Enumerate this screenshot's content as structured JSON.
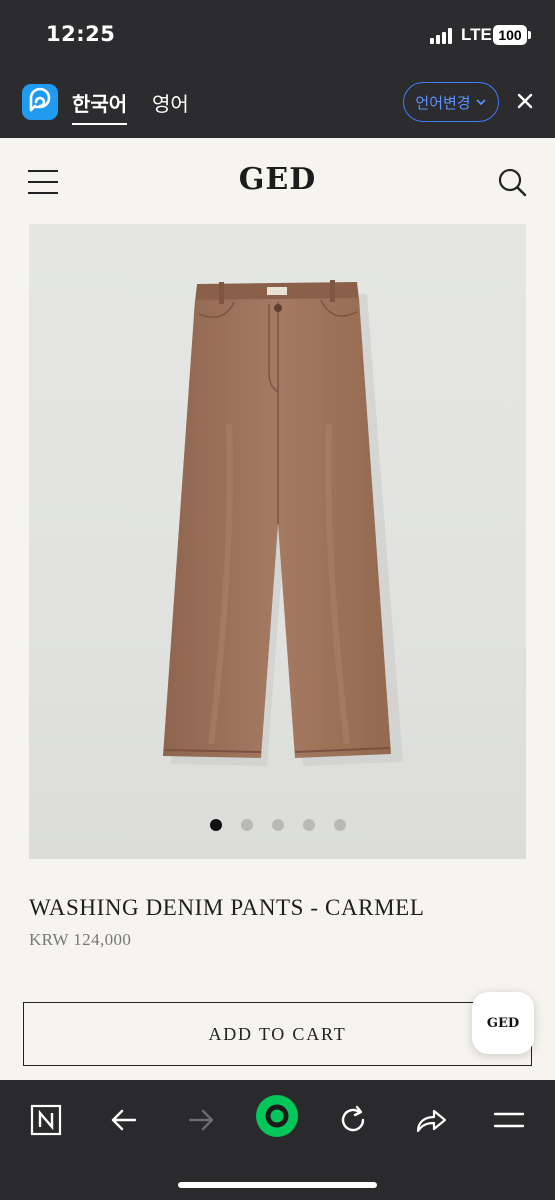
{
  "status_bar": {
    "time": "12:25",
    "network": "LTE",
    "battery": "100"
  },
  "translate_bar": {
    "tab_active": "한국어",
    "tab_other": "영어",
    "change_language": "언어변경"
  },
  "site": {
    "logo": "GED"
  },
  "product": {
    "title": "WASHING DENIM PANTS - CARMEL",
    "price": "KRW 124,000",
    "add_to_cart": "ADD TO CART",
    "image_count": 5,
    "active_image": 1
  },
  "floating_badge": {
    "label": "GED"
  },
  "colors": {
    "chrome_dark": "#2c2c2e",
    "accent_blue": "#3d7dff",
    "page_bg": "#f6f4ef",
    "naver_green": "#03c75a",
    "pants_brown": "#9a6f58"
  },
  "browser_toolbar": {
    "icons": [
      "naver-n-icon",
      "back-arrow-icon",
      "forward-arrow-icon",
      "naver-green-dot-icon",
      "reload-icon",
      "share-icon",
      "menu-icon"
    ]
  }
}
